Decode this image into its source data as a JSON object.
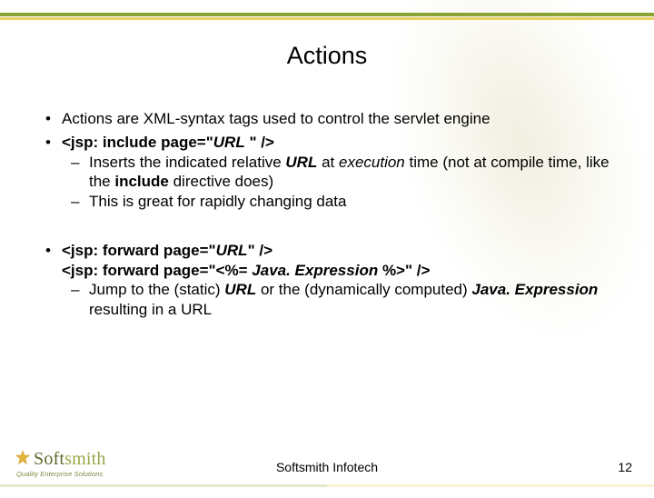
{
  "title": "Actions",
  "bullets": {
    "b1": "Actions are XML-syntax tags used to control the servlet engine",
    "b2_code": "<jsp: include page=\"",
    "b2_url": "URL",
    "b2_code_end": " \" />",
    "b2_sub1_pre": "Inserts the indicated relative ",
    "b2_sub1_url": "URL",
    "b2_sub1_mid": " at ",
    "b2_sub1_exec": "execution",
    "b2_sub1_mid2": " time (not at compile time, like the ",
    "b2_sub1_inc": "include",
    "b2_sub1_end": " directive does)",
    "b2_sub2": "This is great for rapidly changing data",
    "b3_l1_a": "<jsp: forward page=\"",
    "b3_l1_url": "URL",
    "b3_l1_b": "\" />",
    "b3_l2_a": "<jsp: forward page=\"<%= ",
    "b3_l2_expr": "Java. Expression",
    "b3_l2_b": " %>\" />",
    "b3_sub1_pre": "Jump to the (static) ",
    "b3_sub1_url": "URL",
    "b3_sub1_mid": " or the (dynamically computed) ",
    "b3_sub1_expr": "Java. Expression",
    "b3_sub1_end": " resulting in a URL"
  },
  "logo": {
    "soft": "Soft",
    "smith": "smith",
    "tagline": "Quality Enterprise Solutions"
  },
  "footer": "Softsmith Infotech",
  "page": "12"
}
